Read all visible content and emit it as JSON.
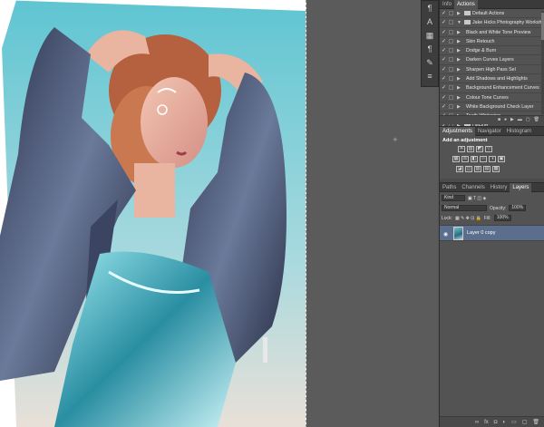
{
  "toolstrip": {
    "tools": [
      "ti-icon",
      "ai-icon",
      "hist-icon",
      "paragraph-icon",
      "brush-icon",
      "layers-icon",
      "adjust-icon"
    ],
    "glyphs": [
      "¶",
      "A",
      "▦",
      "¶",
      "✎",
      "≡",
      "◐"
    ]
  },
  "actions_panel": {
    "tabs": [
      "Info",
      "Actions"
    ],
    "rows": [
      {
        "label": "Default Actions",
        "type": "set"
      },
      {
        "label": "Jake Hicks Photography Worksho...",
        "type": "set"
      },
      {
        "label": "Black and White Tone Preview",
        "type": "action"
      },
      {
        "label": "Skin Retouch",
        "type": "action"
      },
      {
        "label": "Dodge & Burn",
        "type": "action"
      },
      {
        "label": "Darken Curves Layers",
        "type": "action"
      },
      {
        "label": "Sharpen High Pass Sel",
        "type": "action"
      },
      {
        "label": "Add Shadows and Highlights",
        "type": "action"
      },
      {
        "label": "Background Enhancement Curves",
        "type": "action"
      },
      {
        "label": "Colour Tone Curves",
        "type": "action"
      },
      {
        "label": "White Background Check Layer",
        "type": "action"
      },
      {
        "label": "Teeth Whitening",
        "type": "action"
      },
      {
        "label": "DeFluff",
        "type": "set"
      }
    ],
    "footer": [
      "■",
      "●",
      "▶",
      "▬",
      "▢",
      "🗑"
    ]
  },
  "adjustments_panel": {
    "tabs": [
      "Adjustments",
      "Navigator",
      "Histogram"
    ],
    "title": "Add an adjustment",
    "row1": [
      "☀",
      "▥",
      "◩",
      "▽"
    ],
    "row2": [
      "▦",
      "⚖",
      "◧",
      "♲",
      "◑",
      "▣"
    ],
    "row3": [
      "◪",
      "◫",
      "▨",
      "▤",
      "▩"
    ]
  },
  "layers_panel": {
    "tabs": [
      "Paths",
      "Channels",
      "History",
      "Layers"
    ],
    "kind": "Kind",
    "blend_mode": "Normal",
    "opacity_label": "Opacity:",
    "opacity_value": "100%",
    "lock_label": "Lock:",
    "fill_label": "Fill:",
    "fill_value": "100%",
    "layer_name": "Layer 0 copy",
    "footer": [
      "∞",
      "fx",
      "◘",
      "◐",
      "▭",
      "▢",
      "🗑"
    ]
  }
}
